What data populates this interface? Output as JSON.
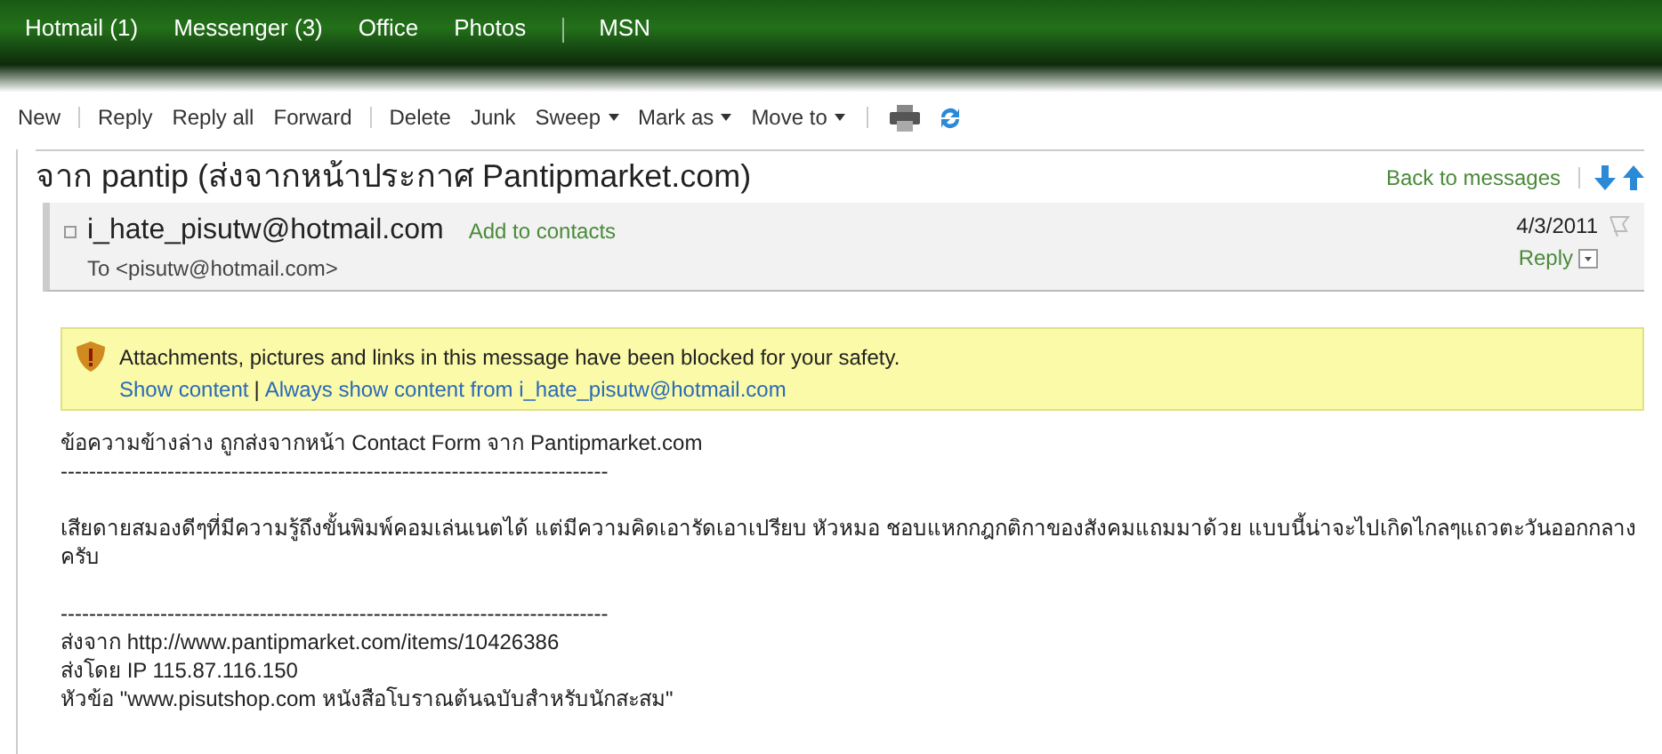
{
  "top_nav": [
    {
      "label": "Hotmail (1)",
      "divider_before": false
    },
    {
      "label": "Messenger (3)",
      "divider_before": false
    },
    {
      "label": "Office",
      "divider_before": false
    },
    {
      "label": "Photos",
      "divider_before": false
    },
    {
      "label": "MSN",
      "divider_before": true
    }
  ],
  "toolbar": [
    [
      {
        "label": "New",
        "has_menu": false
      }
    ],
    [
      {
        "label": "Reply",
        "has_menu": false
      },
      {
        "label": "Reply all",
        "has_menu": false
      },
      {
        "label": "Forward",
        "has_menu": false
      }
    ],
    [
      {
        "label": "Delete",
        "has_menu": false
      },
      {
        "label": "Junk",
        "has_menu": false
      },
      {
        "label": "Sweep",
        "has_menu": true
      },
      {
        "label": "Mark as",
        "has_menu": true
      },
      {
        "label": "Move to",
        "has_menu": true
      }
    ]
  ],
  "subject": "จาก pantip (ส่งจากหน้าประกาศ Pantipmarket.com)",
  "back_link": "Back to messages",
  "header": {
    "from": "i_hate_pisutw@hotmail.com",
    "add_contact": "Add to contacts",
    "to": "To <pisutw@hotmail.com>",
    "date": "4/3/2011",
    "reply": "Reply"
  },
  "banner": {
    "message": "Attachments, pictures and links in this message have been blocked for your safety.",
    "show_content": "Show content",
    "separator": "|",
    "always_show": "Always show content from i_hate_pisutw@hotmail.com"
  },
  "body_paragraphs": [
    [
      "ข้อความข้างล่าง ถูกส่งจากหน้า Contact Form จาก Pantipmarket.com",
      "-----------------------------------------------------------------------------"
    ],
    [
      "เสียดายสมองดีๆที่มีความรู้ถึงขั้นพิมพ์คอมเล่นเนตได้ แต่มีความคิดเอารัดเอาเปรียบ หัวหมอ ชอบแหกกฎกติกาของสังคมแถมมาด้วย แบบนี้น่าจะไปเกิดไกลๆแถวตะวันออกกลางครับ"
    ],
    [
      "-----------------------------------------------------------------------------",
      "ส่งจาก http://www.pantipmarket.com/items/10426386",
      "ส่งโดย IP 115.87.116.150",
      "หัวข้อ \"www.pisutshop.com หนังสือโบราณต้นฉบับสำหรับนักสะสม\""
    ]
  ]
}
